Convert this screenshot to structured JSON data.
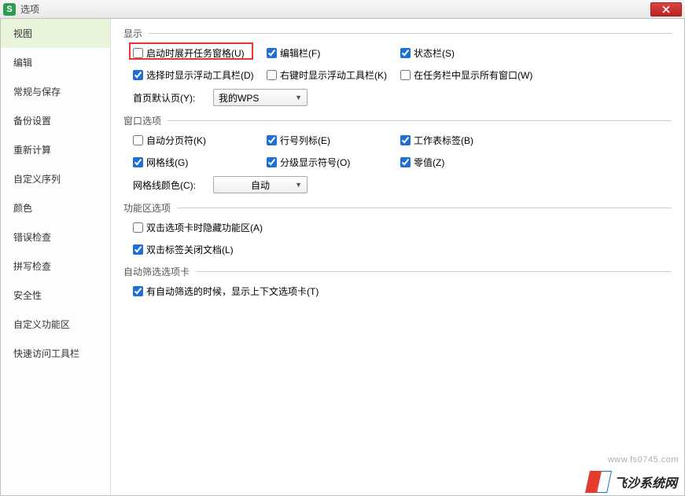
{
  "window": {
    "title": "选项",
    "app_icon_letter": "S"
  },
  "sidebar": {
    "items": [
      {
        "label": "视图",
        "active": true
      },
      {
        "label": "编辑"
      },
      {
        "label": "常规与保存"
      },
      {
        "label": "备份设置"
      },
      {
        "label": "重新计算"
      },
      {
        "label": "自定义序列"
      },
      {
        "label": "颜色"
      },
      {
        "label": "错误检查"
      },
      {
        "label": "拼写检查"
      },
      {
        "label": "安全性"
      },
      {
        "label": "自定义功能区"
      },
      {
        "label": "快速访问工具栏"
      }
    ]
  },
  "groups": {
    "display": {
      "title": "显示",
      "opts": {
        "startup_task_pane": {
          "label": "启动时展开任务窗格(U)",
          "checked": false
        },
        "formula_bar": {
          "label": "编辑栏(F)",
          "checked": true
        },
        "status_bar": {
          "label": "状态栏(S)",
          "checked": true
        },
        "float_select": {
          "label": "选择时显示浮动工具栏(D)",
          "checked": true
        },
        "float_right": {
          "label": "右键时显示浮动工具栏(K)",
          "checked": false
        },
        "taskbar_all": {
          "label": "在任务栏中显示所有窗口(W)",
          "checked": false
        }
      },
      "default_page": {
        "label": "首页默认页(Y):",
        "value": "我的WPS"
      }
    },
    "win": {
      "title": "窗口选项",
      "opts": {
        "page_break": {
          "label": "自动分页符(K)",
          "checked": false
        },
        "row_col_head": {
          "label": "行号列标(E)",
          "checked": true
        },
        "sheet_tabs": {
          "label": "工作表标签(B)",
          "checked": true
        },
        "gridlines": {
          "label": "网格线(G)",
          "checked": true
        },
        "outline": {
          "label": "分级显示符号(O)",
          "checked": true
        },
        "zero": {
          "label": "零值(Z)",
          "checked": true
        }
      },
      "grid_color": {
        "label": "网格线颜色(C):",
        "value": "自动"
      }
    },
    "ribbon": {
      "title": "功能区选项",
      "opts": {
        "dbl_tab_hide": {
          "label": "双击选项卡时隐藏功能区(A)",
          "checked": false
        },
        "dbl_tab_close": {
          "label": "双击标签关闭文档(L)",
          "checked": true
        }
      }
    },
    "filter": {
      "title": "自动筛选选项卡",
      "opts": {
        "show_context": {
          "label": "有自动筛选的时候，显示上下文选项卡(T)",
          "checked": true
        }
      }
    }
  },
  "watermark": "www.fs0745.com",
  "brand": "飞沙系统网"
}
